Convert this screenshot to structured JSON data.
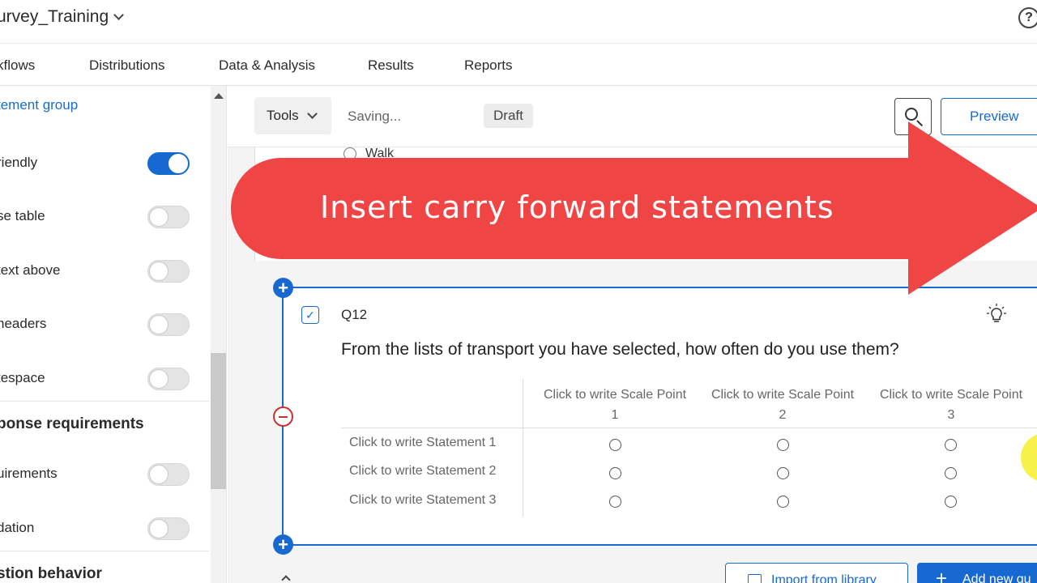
{
  "header": {
    "survey_title": "urvey_Training",
    "help_label": "?"
  },
  "nav": {
    "items": [
      "kflows",
      "Distributions",
      "Data & Analysis",
      "Results",
      "Reports"
    ]
  },
  "sidebar": {
    "link": "tement group",
    "toggles": [
      {
        "label": "riendly",
        "on": true
      },
      {
        "label": "se table",
        "on": false
      },
      {
        "label": " text above",
        "on": false
      },
      {
        "label": "headers",
        "on": false
      },
      {
        "label": "tespace",
        "on": false
      }
    ],
    "section_response": "ponse requirements",
    "response_toggles": [
      {
        "label": "uirements",
        "on": false
      },
      {
        "label": "dation",
        "on": false
      }
    ],
    "section_behavior": "stion behavior"
  },
  "toolbar": {
    "tools_label": "Tools",
    "saving_text": "Saving...",
    "draft_badge": "Draft",
    "preview_label": "Preview"
  },
  "previous_question": {
    "option_text": "Walk"
  },
  "overlay": {
    "banner_text": "Insert carry forward statements"
  },
  "question": {
    "number": "Q12",
    "text": "From the lists of transport you have selected, how often do you use them?",
    "scale_points": [
      {
        "line1": "Click to write Scale Point",
        "line2": "1"
      },
      {
        "line1": "Click to write Scale Point",
        "line2": "2"
      },
      {
        "line1": "Click to write Scale Point",
        "line2": "3"
      }
    ],
    "statements": [
      "Click to write Statement 1",
      "Click to write Statement 2",
      "Click to write Statement 3"
    ]
  },
  "footer": {
    "import_label": "Import from library",
    "add_new_label": "Add new qu"
  },
  "colors": {
    "accent": "#1769d1",
    "banner": "#f04545",
    "danger": "#c93030"
  }
}
